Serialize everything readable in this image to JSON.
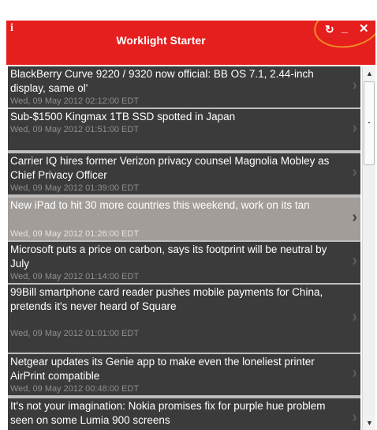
{
  "app": {
    "title": "Worklight Starter",
    "info_label": "i",
    "refresh_glyph": "↻",
    "minimize_glyph": "_",
    "close_glyph": "✕"
  },
  "colors": {
    "titlebar": "#e51e1e",
    "item_bg": "#3b3b3b",
    "item_selected_bg": "#a29d99",
    "annotation_ring": "#f08a24"
  },
  "feed": {
    "items": [
      {
        "title": "BlackBerry Curve 9220 / 9320 now official: BB OS 7.1, 2.44-inch display, same ol'",
        "date": "Wed, 09 May 2012 02:12:00 EDT",
        "selected": false
      },
      {
        "title": "Sub-$1500 Kingmax 1TB SSD spotted in Japan",
        "date": "Wed, 09 May 2012 01:51:00 EDT",
        "selected": false
      },
      {
        "title": "Carrier IQ hires former Verizon privacy counsel Magnolia Mobley as Chief Privacy Officer",
        "date": "Wed, 09 May 2012 01:39:00 EDT",
        "selected": false
      },
      {
        "title": "New iPad to hit 30 more countries this weekend, work on its tan",
        "date": "Wed, 09 May 2012 01:26:00 EDT",
        "selected": true
      },
      {
        "title": "Microsoft puts a price on carbon, says its footprint will be neutral by July",
        "date": "Wed, 09 May 2012 01:14:00 EDT",
        "selected": false
      },
      {
        "title": "99Bill smartphone card reader pushes mobile payments for China, pretends it's never heard of Square",
        "date": "Wed, 09 May 2012 01:01:00 EDT",
        "selected": false
      },
      {
        "title": "Netgear updates its Genie app to make even the loneliest printer AirPrint compatible",
        "date": "Wed, 09 May 2012 00:48:00 EDT",
        "selected": false
      },
      {
        "title": "It's not your imagination: Nokia promises fix for purple hue problem seen on some Lumia 900 screens",
        "date": "",
        "selected": false
      }
    ]
  },
  "scrollbar": {
    "up_glyph": "▲",
    "down_glyph": "▼"
  }
}
